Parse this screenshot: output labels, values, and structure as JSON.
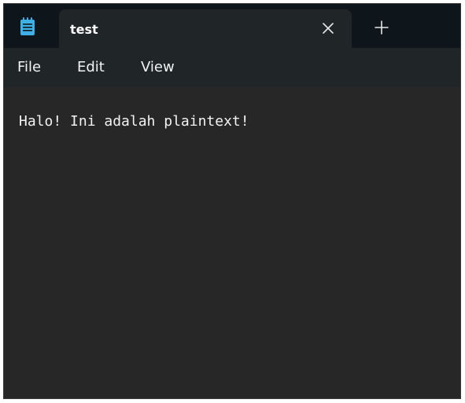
{
  "titlebar": {
    "app_icon": "notepad-icon",
    "tab": {
      "title": "test",
      "close_icon": "close-icon"
    },
    "new_tab_icon": "plus-icon"
  },
  "menu": {
    "items": [
      {
        "label": "File"
      },
      {
        "label": "Edit"
      },
      {
        "label": "View"
      }
    ]
  },
  "editor": {
    "content": "Halo! Ini adalah plaintext!"
  },
  "colors": {
    "titlebar_bg": "#0f161b",
    "tab_bg": "#202628",
    "editor_bg": "#272727",
    "text": "#f2f2f2",
    "icon_accent": "#3fb0e6"
  }
}
